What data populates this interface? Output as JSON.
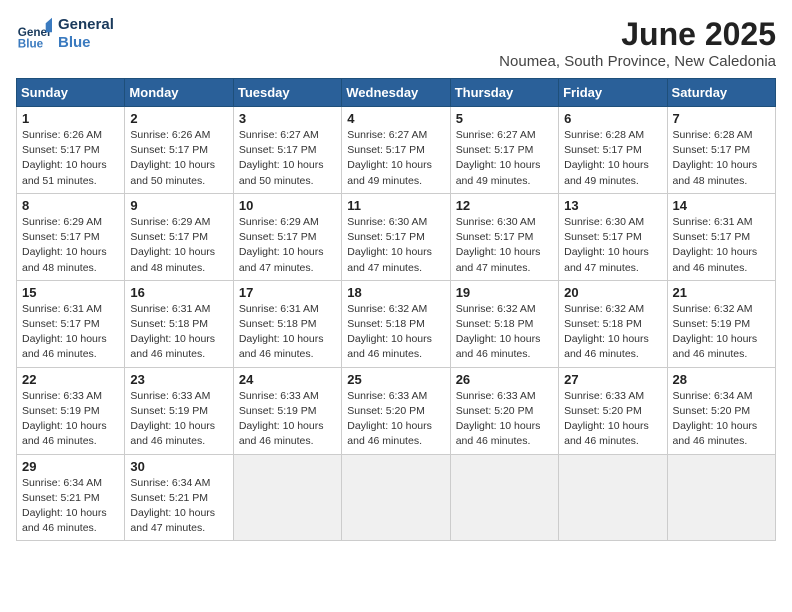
{
  "logo": {
    "line1": "General",
    "line2": "Blue"
  },
  "title": "June 2025",
  "location": "Noumea, South Province, New Caledonia",
  "weekdays": [
    "Sunday",
    "Monday",
    "Tuesday",
    "Wednesday",
    "Thursday",
    "Friday",
    "Saturday"
  ],
  "weeks": [
    [
      {
        "day": 1,
        "sunrise": "6:26 AM",
        "sunset": "5:17 PM",
        "daylight": "10 hours and 51 minutes."
      },
      {
        "day": 2,
        "sunrise": "6:26 AM",
        "sunset": "5:17 PM",
        "daylight": "10 hours and 50 minutes."
      },
      {
        "day": 3,
        "sunrise": "6:27 AM",
        "sunset": "5:17 PM",
        "daylight": "10 hours and 50 minutes."
      },
      {
        "day": 4,
        "sunrise": "6:27 AM",
        "sunset": "5:17 PM",
        "daylight": "10 hours and 49 minutes."
      },
      {
        "day": 5,
        "sunrise": "6:27 AM",
        "sunset": "5:17 PM",
        "daylight": "10 hours and 49 minutes."
      },
      {
        "day": 6,
        "sunrise": "6:28 AM",
        "sunset": "5:17 PM",
        "daylight": "10 hours and 49 minutes."
      },
      {
        "day": 7,
        "sunrise": "6:28 AM",
        "sunset": "5:17 PM",
        "daylight": "10 hours and 48 minutes."
      }
    ],
    [
      {
        "day": 8,
        "sunrise": "6:29 AM",
        "sunset": "5:17 PM",
        "daylight": "10 hours and 48 minutes."
      },
      {
        "day": 9,
        "sunrise": "6:29 AM",
        "sunset": "5:17 PM",
        "daylight": "10 hours and 48 minutes."
      },
      {
        "day": 10,
        "sunrise": "6:29 AM",
        "sunset": "5:17 PM",
        "daylight": "10 hours and 47 minutes."
      },
      {
        "day": 11,
        "sunrise": "6:30 AM",
        "sunset": "5:17 PM",
        "daylight": "10 hours and 47 minutes."
      },
      {
        "day": 12,
        "sunrise": "6:30 AM",
        "sunset": "5:17 PM",
        "daylight": "10 hours and 47 minutes."
      },
      {
        "day": 13,
        "sunrise": "6:30 AM",
        "sunset": "5:17 PM",
        "daylight": "10 hours and 47 minutes."
      },
      {
        "day": 14,
        "sunrise": "6:31 AM",
        "sunset": "5:17 PM",
        "daylight": "10 hours and 46 minutes."
      }
    ],
    [
      {
        "day": 15,
        "sunrise": "6:31 AM",
        "sunset": "5:17 PM",
        "daylight": "10 hours and 46 minutes."
      },
      {
        "day": 16,
        "sunrise": "6:31 AM",
        "sunset": "5:18 PM",
        "daylight": "10 hours and 46 minutes."
      },
      {
        "day": 17,
        "sunrise": "6:31 AM",
        "sunset": "5:18 PM",
        "daylight": "10 hours and 46 minutes."
      },
      {
        "day": 18,
        "sunrise": "6:32 AM",
        "sunset": "5:18 PM",
        "daylight": "10 hours and 46 minutes."
      },
      {
        "day": 19,
        "sunrise": "6:32 AM",
        "sunset": "5:18 PM",
        "daylight": "10 hours and 46 minutes."
      },
      {
        "day": 20,
        "sunrise": "6:32 AM",
        "sunset": "5:18 PM",
        "daylight": "10 hours and 46 minutes."
      },
      {
        "day": 21,
        "sunrise": "6:32 AM",
        "sunset": "5:19 PM",
        "daylight": "10 hours and 46 minutes."
      }
    ],
    [
      {
        "day": 22,
        "sunrise": "6:33 AM",
        "sunset": "5:19 PM",
        "daylight": "10 hours and 46 minutes."
      },
      {
        "day": 23,
        "sunrise": "6:33 AM",
        "sunset": "5:19 PM",
        "daylight": "10 hours and 46 minutes."
      },
      {
        "day": 24,
        "sunrise": "6:33 AM",
        "sunset": "5:19 PM",
        "daylight": "10 hours and 46 minutes."
      },
      {
        "day": 25,
        "sunrise": "6:33 AM",
        "sunset": "5:20 PM",
        "daylight": "10 hours and 46 minutes."
      },
      {
        "day": 26,
        "sunrise": "6:33 AM",
        "sunset": "5:20 PM",
        "daylight": "10 hours and 46 minutes."
      },
      {
        "day": 27,
        "sunrise": "6:33 AM",
        "sunset": "5:20 PM",
        "daylight": "10 hours and 46 minutes."
      },
      {
        "day": 28,
        "sunrise": "6:34 AM",
        "sunset": "5:20 PM",
        "daylight": "10 hours and 46 minutes."
      }
    ],
    [
      {
        "day": 29,
        "sunrise": "6:34 AM",
        "sunset": "5:21 PM",
        "daylight": "10 hours and 46 minutes."
      },
      {
        "day": 30,
        "sunrise": "6:34 AM",
        "sunset": "5:21 PM",
        "daylight": "10 hours and 47 minutes."
      },
      null,
      null,
      null,
      null,
      null
    ]
  ]
}
